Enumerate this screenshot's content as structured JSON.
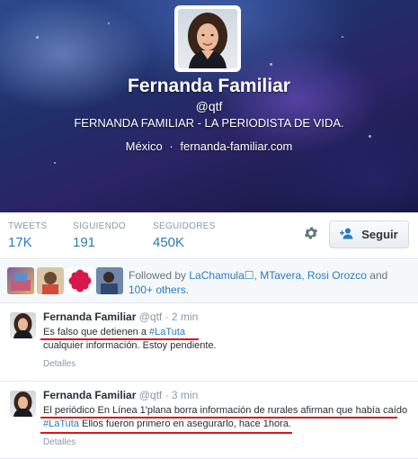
{
  "profile": {
    "name": "Fernanda Familiar",
    "handle": "@qtf",
    "bio": "FERNANDA FAMILIAR - LA PERIODISTA DE VIDA.",
    "location": "México",
    "separator": "·",
    "website": "fernanda-familiar.com"
  },
  "stats": {
    "tweets_label": "TWEETS",
    "tweets_value": "17K",
    "following_label": "SIGUIENDO",
    "following_value": "191",
    "followers_label": "SEGUIDORES",
    "followers_value": "450K"
  },
  "actions": {
    "settings_icon": "gear-icon",
    "follow_label": "Seguir",
    "follow_icon": "add-user-icon"
  },
  "followed_by": {
    "prefix": "Followed by",
    "user1": "LaChamula",
    "user1_badge": "☐",
    "comma1": ",",
    "user2": "MTavera",
    "comma2": ",",
    "user3": "Rosi Orozco",
    "and": "and",
    "more": "100+ others."
  },
  "tweets": [
    {
      "name": "Fernanda Familiar",
      "handle": "@qtf",
      "time": "· 2 min",
      "text_a": "Es falso que detienen a ",
      "hashtag": "#LaTuta",
      "text_b": "cualquier información. Estoy pendiente.",
      "details": "Detalles"
    },
    {
      "name": "Fernanda Familiar",
      "handle": "@qtf",
      "time": "· 3 min",
      "text_a": "El periódico En Línea 1'plana borra información de rurales afirman que había caído",
      "hashtag": "#LaTuta",
      "text_b": " Ellos fueron primero en asegurarlo, hace 1hora.",
      "details": "Detalles"
    }
  ],
  "colors": {
    "link": "#2a7bbd",
    "annotation_underline": "#d8161c"
  }
}
